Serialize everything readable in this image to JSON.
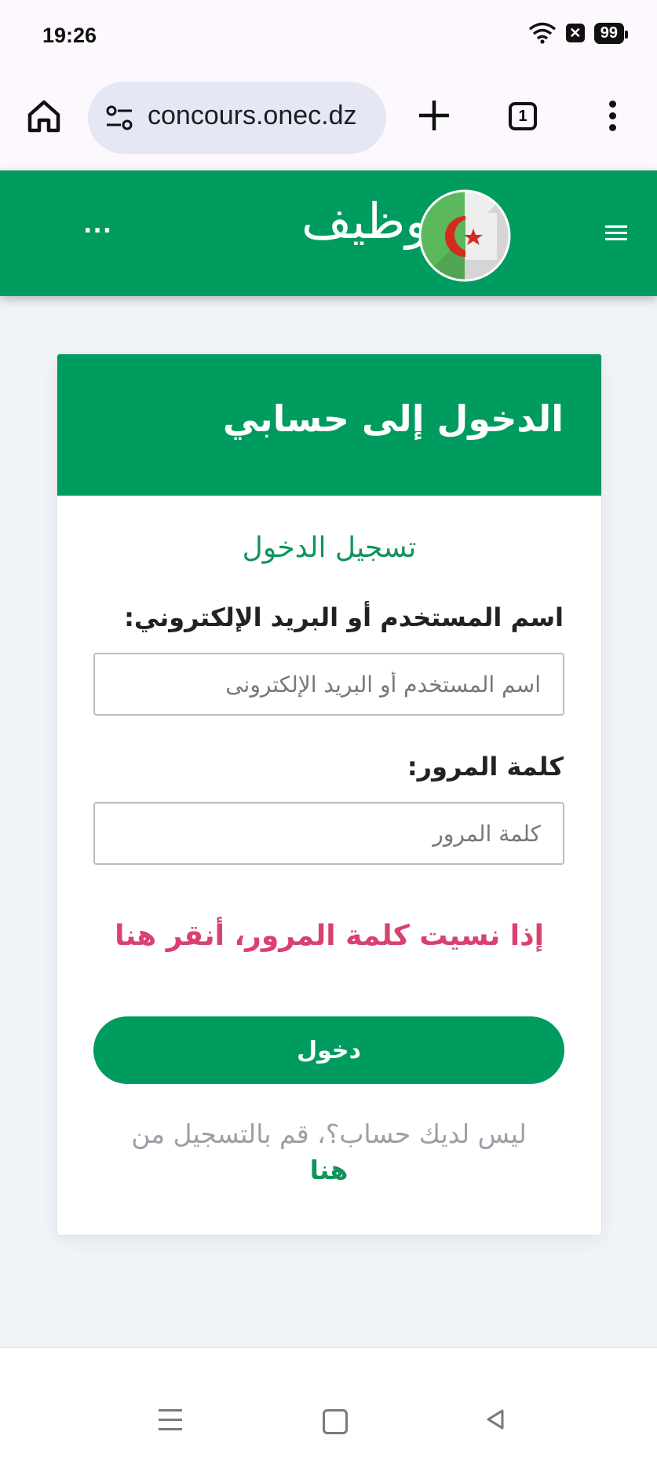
{
  "status_bar": {
    "time": "19:26",
    "battery": "99",
    "icons": [
      "wifi-icon",
      "notification-x-icon",
      "battery-icon"
    ]
  },
  "browser": {
    "url": "concours.onec.dz",
    "tab_count": "1",
    "icons": [
      "home-icon",
      "site-settings-icon",
      "new-tab-icon",
      "tabs-icon",
      "more-vert-icon"
    ]
  },
  "site_header": {
    "logo_text": "توظيف",
    "more_dots": "...",
    "icons": [
      "algeria-flag-icon",
      "hamburger-menu-icon"
    ]
  },
  "login_card": {
    "title": "الدخول إلى حسابي",
    "subtitle": "تسجيل الدخول",
    "username_label": "اسم المستخدم أو البريد الإلكتروني:",
    "username_placeholder": "اسم المستخدم أو البريد الإلكترونى",
    "username_value": "",
    "password_label": "كلمة المرور:",
    "password_placeholder": "كلمة المرور",
    "password_value": "",
    "forgot_password": "إذا نسيت كلمة المرور، أنقر هنا",
    "submit_label": "دخول",
    "register_prompt": "ليس لديك حساب؟، قم بالتسجيل من",
    "register_link": "هنا"
  },
  "colors": {
    "brand_green": "#009b5e",
    "link_green": "#10945b",
    "forgot_pink": "#d9416f",
    "page_bg": "#f0f4f9"
  },
  "nav_bar": {
    "icons": [
      "recent-apps-icon",
      "home-nav-icon",
      "back-nav-icon"
    ]
  }
}
